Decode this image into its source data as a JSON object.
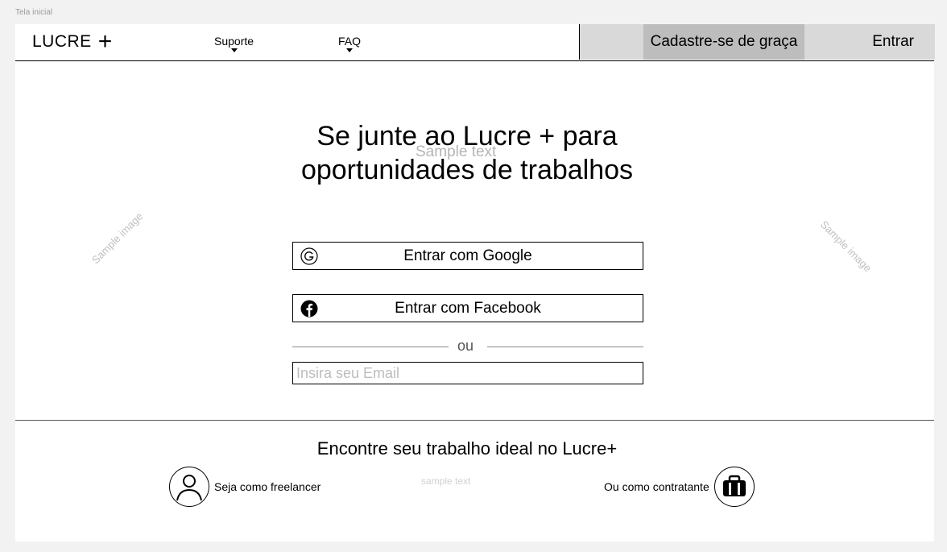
{
  "frame_label": "Tela inicial",
  "nav": {
    "logo": "LUCRE",
    "logo_plus": "+",
    "links": [
      {
        "label": "Suporte"
      },
      {
        "label": "FAQ"
      }
    ],
    "signup_label": "Cadastre-se de graça",
    "login_label": "Entrar"
  },
  "hero": {
    "title_line1": "Se junte ao Lucre + para",
    "title_line2": "oportunidades de trabalhos",
    "overlay_text": "Sample text",
    "sample_image_left": "Sample image",
    "sample_image_right": "Sample image",
    "google_label": "Entrar com Google",
    "facebook_label": "Entrar com Facebook",
    "divider_text": "ou",
    "email_placeholder": "Insira seu Email"
  },
  "footer": {
    "title": "Encontre seu trabalho ideal no Lucre+",
    "sample_text": "sample text",
    "freelancer_label": "Seja como freelancer",
    "contratante_label": "Ou como contratante"
  },
  "icons": {
    "google": "google-icon",
    "facebook": "facebook-icon",
    "person": "person-icon",
    "briefcase": "briefcase-icon",
    "caret": "chevron-down-icon"
  },
  "colors": {
    "background": "#f2f2f2",
    "frame": "#ffffff",
    "nav_right": "#d9d9d9",
    "signup_button": "#bdbdbd",
    "placeholder": "#bdbdbd"
  }
}
